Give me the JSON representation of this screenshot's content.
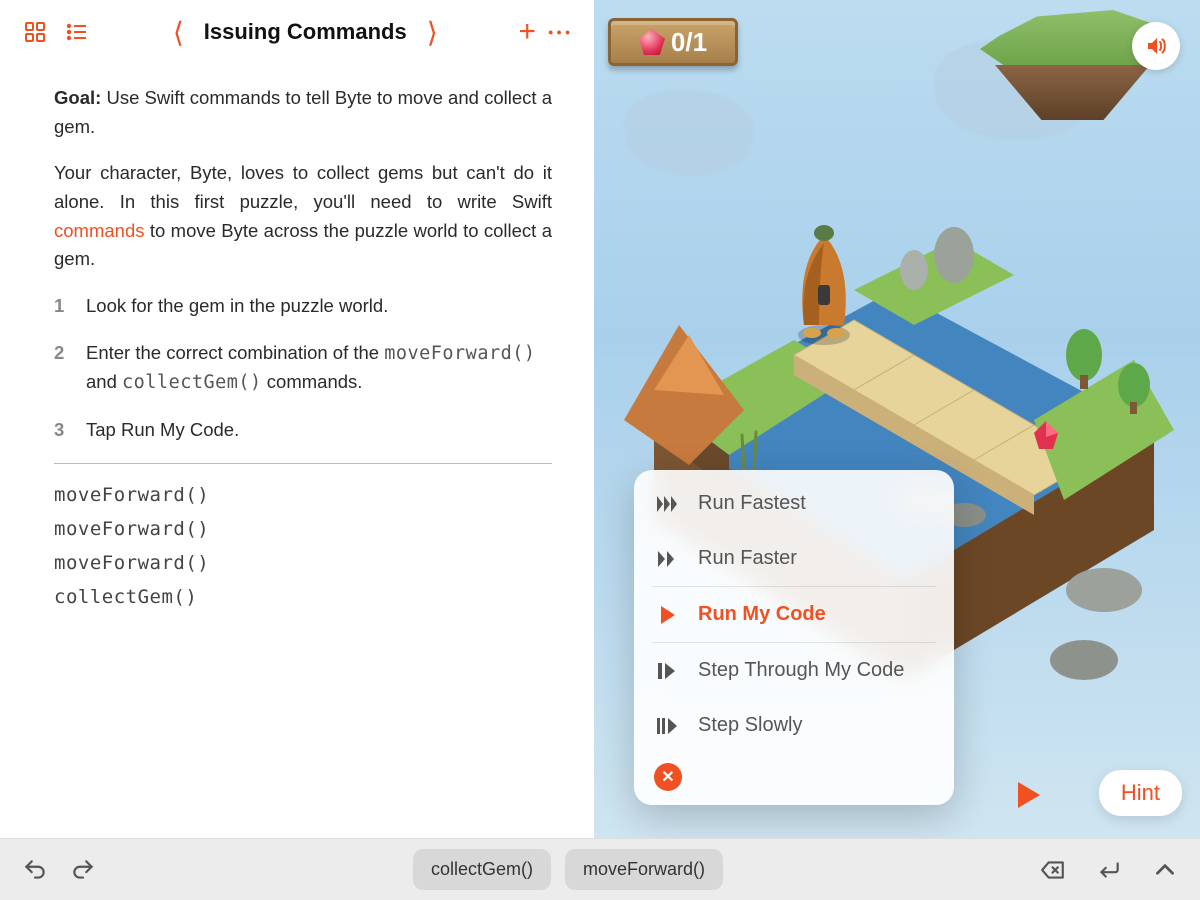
{
  "header": {
    "title": "Issuing Commands"
  },
  "instructions": {
    "goal_label": "Goal:",
    "goal_text": " Use Swift commands to tell Byte to move and collect a gem.",
    "intro_a": "Your character, Byte, loves to collect gems but can't do it alone. In this first puzzle, you'll need to write Swift ",
    "intro_link": "commands",
    "intro_b": " to move Byte across the puzzle world to collect a gem.",
    "steps": [
      {
        "num": "1",
        "text": "Look for the gem in the puzzle world."
      },
      {
        "num": "2",
        "text_a": "Enter the correct combination of the ",
        "code_a": "moveForward()",
        "mid": " and ",
        "code_b": "collectGem()",
        "text_b": " commands."
      },
      {
        "num": "3",
        "text": "Tap Run My Code."
      }
    ]
  },
  "code_lines": [
    "moveForward()",
    "moveForward()",
    "moveForward()",
    "collectGem()"
  ],
  "world": {
    "progress": "0/1"
  },
  "run_menu": {
    "items": [
      {
        "icon": "fastest",
        "label": "Run Fastest",
        "active": false
      },
      {
        "icon": "faster",
        "label": "Run Faster",
        "active": false
      },
      {
        "icon": "play",
        "label": "Run My Code",
        "active": true
      },
      {
        "icon": "step",
        "label": "Step Through My Code",
        "active": false
      },
      {
        "icon": "slow",
        "label": "Step Slowly",
        "active": false
      }
    ]
  },
  "hint_label": "Hint",
  "suggestions": [
    "collectGem()",
    "moveForward()"
  ],
  "colors": {
    "accent": "#f05022"
  }
}
